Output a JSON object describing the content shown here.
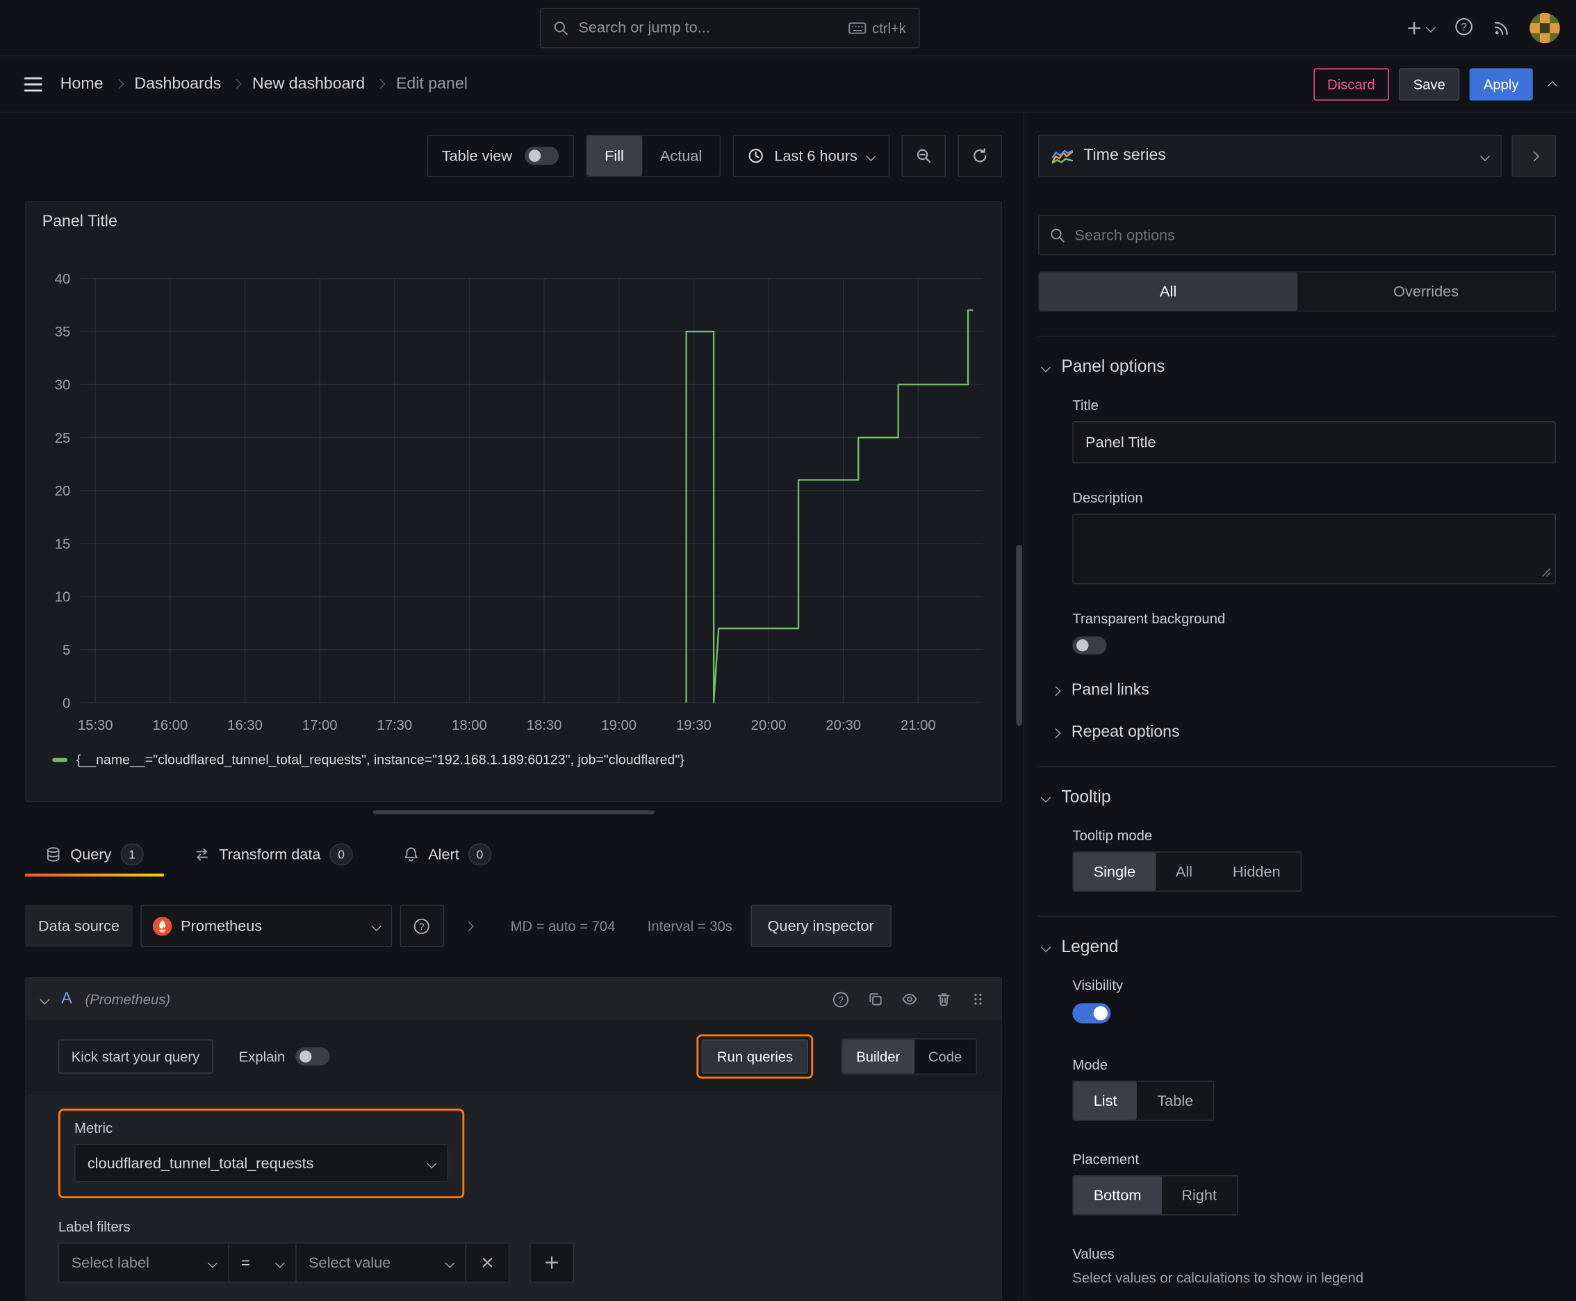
{
  "colors": {
    "blue": "#3d71d9",
    "orange": "#ff780a",
    "green": "#73bf69",
    "pink": "#ff5286"
  },
  "topbar": {
    "search_placeholder": "Search or jump to...",
    "shortcut": "ctrl+k"
  },
  "nav": {
    "breadcrumbs": [
      "Home",
      "Dashboards",
      "New dashboard",
      "Edit panel"
    ],
    "discard_label": "Discard",
    "save_label": "Save",
    "apply_label": "Apply"
  },
  "toolbar": {
    "table_view_label": "Table view",
    "fill_label": "Fill",
    "actual_label": "Actual",
    "time_range_label": "Last 6 hours"
  },
  "panel": {
    "title": "Panel Title",
    "legend_label": "{__name__=\"cloudflared_tunnel_total_requests\", instance=\"192.168.1.189:60123\", job=\"cloudflared\"}"
  },
  "chart_data": {
    "type": "line",
    "line_mode": "stepped",
    "series_color": "#73bf69",
    "title": "Panel Title",
    "x_ticks": [
      "15:30",
      "16:00",
      "16:30",
      "17:00",
      "17:30",
      "18:00",
      "18:30",
      "19:00",
      "19:30",
      "20:00",
      "20:30",
      "21:00"
    ],
    "y_ticks": [
      0,
      5,
      10,
      15,
      20,
      25,
      30,
      35,
      40
    ],
    "ylim": [
      0,
      40
    ],
    "x_range": [
      "15:24",
      "21:26"
    ],
    "grid": true,
    "legend_position": "bottom",
    "series": [
      {
        "name": "{__name__=\"cloudflared_tunnel_total_requests\", instance=\"192.168.1.189:60123\", job=\"cloudflared\"}",
        "points": [
          [
            "19:27",
            0
          ],
          [
            "19:27",
            35
          ],
          [
            "19:38",
            35
          ],
          [
            "19:38",
            0
          ],
          [
            "19:40",
            7
          ],
          [
            "20:12",
            7
          ],
          [
            "20:12",
            21
          ],
          [
            "20:36",
            21
          ],
          [
            "20:36",
            25
          ],
          [
            "20:52",
            25
          ],
          [
            "20:52",
            30
          ],
          [
            "21:20",
            30
          ],
          [
            "21:20",
            37
          ],
          [
            "21:22",
            37
          ]
        ]
      }
    ]
  },
  "query_tabs": {
    "query": {
      "label": "Query",
      "count": "1"
    },
    "transform": {
      "label": "Transform data",
      "count": "0"
    },
    "alert": {
      "label": "Alert",
      "count": "0"
    }
  },
  "query_editor": {
    "datasource_label": "Data source",
    "datasource_name": "Prometheus",
    "stats_md": "MD = auto = 704",
    "stats_interval": "Interval = 30s",
    "query_inspector_label": "Query inspector",
    "ref_id": "A",
    "ref_ds": "(Prometheus)",
    "kick_start_label": "Kick start your query",
    "explain_label": "Explain",
    "run_queries_label": "Run queries",
    "builder_label": "Builder",
    "code_label": "Code",
    "metric_label": "Metric",
    "metric_value": "cloudflared_tunnel_total_requests",
    "label_filters_label": "Label filters",
    "select_label_placeholder": "Select label",
    "operator_value": "=",
    "select_value_placeholder": "Select value"
  },
  "viz_picker": {
    "name": "Time series"
  },
  "options_pane": {
    "search_placeholder": "Search options",
    "tab_all": "All",
    "tab_overrides": "Overrides",
    "panel_options_title": "Panel options",
    "title_label": "Title",
    "title_value": "Panel Title",
    "description_label": "Description",
    "transparent_label": "Transparent background",
    "panel_links_label": "Panel links",
    "repeat_options_label": "Repeat options",
    "tooltip_title": "Tooltip",
    "tooltip_mode_label": "Tooltip mode",
    "tooltip_modes": [
      "Single",
      "All",
      "Hidden"
    ],
    "legend_title": "Legend",
    "visibility_label": "Visibility",
    "mode_label": "Mode",
    "legend_modes": [
      "List",
      "Table"
    ],
    "placement_label": "Placement",
    "placements": [
      "Bottom",
      "Right"
    ],
    "values_label": "Values",
    "values_description": "Select values or calculations to show in legend"
  }
}
